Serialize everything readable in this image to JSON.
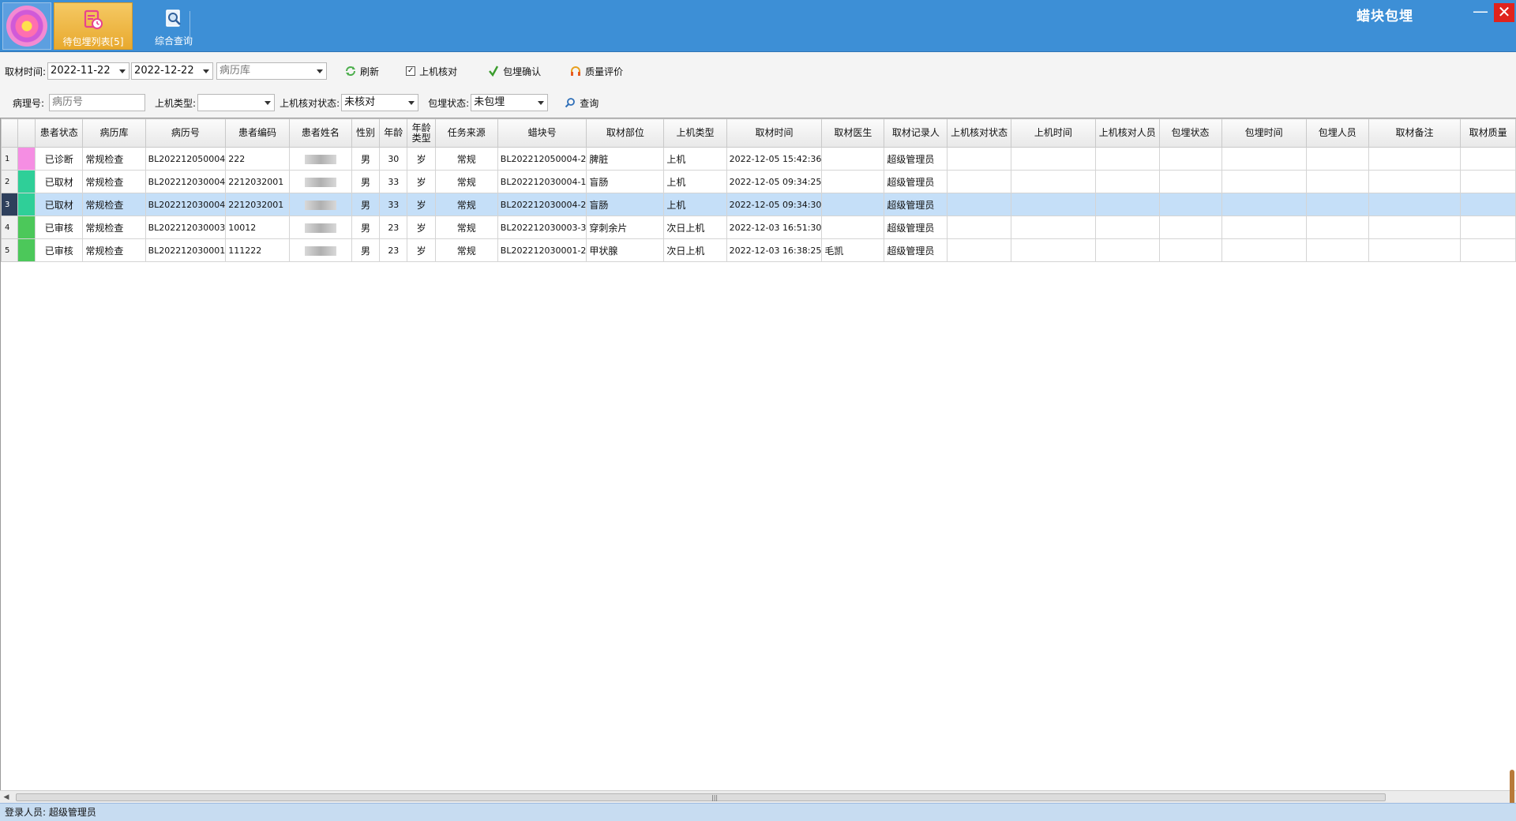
{
  "app": {
    "title": "蜡块包埋",
    "minimize_glyph": "—",
    "close_glyph": "✕"
  },
  "nav": {
    "pending_label": "待包埋列表[5]",
    "query_label": "综合查询"
  },
  "filters": {
    "sample_time_label": "取材时间:",
    "date_from": "2022-11-22",
    "date_to": "2022-12-22",
    "record_db_placeholder": "病历库",
    "refresh_label": "刷新",
    "machine_check_label": "上机核对",
    "machine_check_checked": true,
    "embed_confirm_label": "包埋确认",
    "quality_label": "质量评价",
    "pathology_no_label": "病理号:",
    "pathology_no_placeholder": "病历号",
    "machine_type_label": "上机类型:",
    "machine_type_value": "",
    "check_status_label": "上机核对状态:",
    "check_status_value": "未核对",
    "embed_status_label": "包埋状态:",
    "embed_status_value": "未包埋",
    "search_label": "查询"
  },
  "table": {
    "columns": [
      "患者状态",
      "病历库",
      "病历号",
      "患者编码",
      "患者姓名",
      "性别",
      "年龄",
      "年龄类型",
      "任务来源",
      "蜡块号",
      "取材部位",
      "上机类型",
      "取材时间",
      "取材医生",
      "取材记录人",
      "上机核对状态",
      "上机时间",
      "上机核对人员",
      "包埋状态",
      "包埋时间",
      "包埋人员",
      "取材备注",
      "取材质量"
    ],
    "age_type_header_line1": "年龄",
    "age_type_header_line2": "类型",
    "rows": [
      {
        "num": "1",
        "status_color": "#f58ee3",
        "status": "已诊断",
        "db": "常规检查",
        "record_no": "BL202212050004",
        "patient_code": "222",
        "sex": "男",
        "age": "30",
        "age_type": "岁",
        "source": "常规",
        "block_no": "BL202212050004-2",
        "site": "脾脏",
        "machine_type": "上机",
        "sample_time": "2022-12-05 15:42:36",
        "doctor": "",
        "recorder": "超级管理员"
      },
      {
        "num": "2",
        "status_color": "#2fcf98",
        "status": "已取材",
        "db": "常规检查",
        "record_no": "BL202212030004",
        "patient_code": "2212032001",
        "sex": "男",
        "age": "33",
        "age_type": "岁",
        "source": "常规",
        "block_no": "BL202212030004-1",
        "site": "盲肠",
        "machine_type": "上机",
        "sample_time": "2022-12-05 09:34:25",
        "doctor": "",
        "recorder": "超级管理员"
      },
      {
        "num": "3",
        "status_color": "#2fcf98",
        "status": "已取材",
        "db": "常规检查",
        "record_no": "BL202212030004",
        "patient_code": "2212032001",
        "sex": "男",
        "age": "33",
        "age_type": "岁",
        "source": "常规",
        "block_no": "BL202212030004-2",
        "site": "盲肠",
        "machine_type": "上机",
        "sample_time": "2022-12-05 09:34:30",
        "doctor": "",
        "recorder": "超级管理员"
      },
      {
        "num": "4",
        "status_color": "#4cc85a",
        "status": "已审核",
        "db": "常规检查",
        "record_no": "BL202212030003",
        "patient_code": "10012",
        "sex": "男",
        "age": "23",
        "age_type": "岁",
        "source": "常规",
        "block_no": "BL202212030003-3",
        "site": "穿刺余片",
        "machine_type": "次日上机",
        "sample_time": "2022-12-03 16:51:30",
        "doctor": "",
        "recorder": "超级管理员"
      },
      {
        "num": "5",
        "status_color": "#4cc85a",
        "status": "已审核",
        "db": "常规检查",
        "record_no": "BL202212030001",
        "patient_code": "111222",
        "sex": "男",
        "age": "23",
        "age_type": "岁",
        "source": "常规",
        "block_no": "BL202212030001-2",
        "site": "甲状腺",
        "machine_type": "次日上机",
        "sample_time": "2022-12-03 16:38:25",
        "doctor": "毛凯",
        "recorder": "超级管理员"
      }
    ],
    "selected_row": 2
  },
  "scrollbar": {
    "grip": "|||"
  },
  "status": {
    "login_label": "登录人员: 超级管理员"
  },
  "colors": {
    "topbar": "#3d8fd6",
    "selected_row": "#c5dff8",
    "status_bar": "#c7dcf1"
  }
}
